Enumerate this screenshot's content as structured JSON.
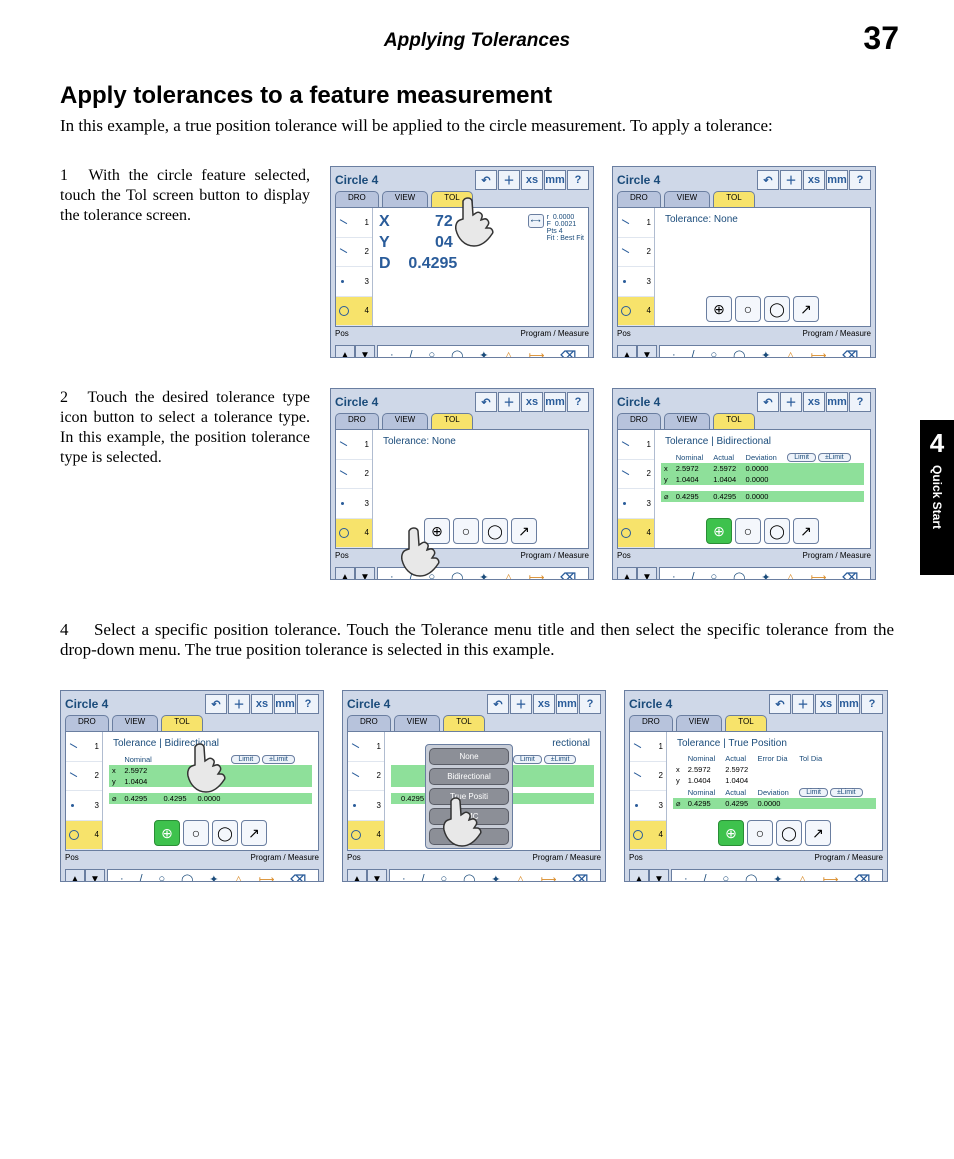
{
  "header": {
    "running_title": "Applying Tolerances",
    "page_number": "37"
  },
  "side_tab": {
    "chapter": "4",
    "label": "Quick Start"
  },
  "section_title": "Apply tolerances to a feature measurement",
  "intro": "In this example, a true position tolerance will be applied to the circle measurement. To apply a tolerance:",
  "steps": {
    "s1": "With the circle feature selected, touch the Tol screen button to display the tolerance screen.",
    "s2": "Touch the desired tolerance type icon button to select a tolerance type.  In this example, the position tolerance type is selected.",
    "s4": "Select a specific position tolerance.  Touch the Tolerance menu title and then select the specific tolerance from the drop-down menu.  The true position tolerance is selected in this example."
  },
  "step_num": {
    "s1": "1",
    "s2": "2",
    "s4": "4"
  },
  "panel": {
    "title": "Circle 4",
    "tabs": {
      "dro": "DRO",
      "view": "VIEW",
      "tol": "TOL"
    },
    "corner": {
      "undo": "↶",
      "plus": "＋",
      "xs": "xs",
      "mm": "mm",
      "help": "?"
    },
    "features": {
      "f1": "1",
      "f2": "2",
      "f3": "3",
      "f4": "4"
    },
    "status": {
      "pos": "Pos",
      "program": "Program",
      "measure": "Measure"
    },
    "arrows": {
      "up": "▲",
      "down": "▼"
    },
    "toolbar": {
      "dot": "·",
      "slash": "/",
      "circle": "○",
      "oval": "◯",
      "angle": "✦",
      "tri": "△",
      "dist": "⟼",
      "erase": "⌫"
    },
    "tol_btns": {
      "pos": "⊕",
      "conc": "○",
      "circ": "◯",
      "runout": "↗"
    }
  },
  "xyd": {
    "x_lbl": "X",
    "y_lbl": "Y",
    "d_lbl": "D",
    "x_val": "72",
    "y_val": "04",
    "d_val": "0.4295"
  },
  "meta": {
    "r2": "0.0000",
    "F": "F",
    "r3": "0.0021",
    "pts": "Pts 4",
    "fit": "Fit : Best Fit"
  },
  "tolerance": {
    "none": "Tolerance:  None",
    "bidir": "Tolerance | Bidirectional",
    "bidir_short": "rectional",
    "truepos": "Tolerance | True Position"
  },
  "table": {
    "hdr": {
      "nominal": "Nominal",
      "actual": "Actual",
      "dev": "Deviation",
      "limit": "Limit",
      "pLimit": "±Limit",
      "errdia": "Error Dia",
      "toldia": "Tol Dia"
    },
    "x": "x",
    "y": "y",
    "d": "⌀",
    "r1c1": "2.5972",
    "r1c2": "2.5972",
    "r1c3": "0.0000",
    "r2c1": "1.0404",
    "r2c2": "1.0404",
    "r2c3": "0.0000",
    "r3c1": "0.4295",
    "r3c2": "0.4295",
    "r3c3": "0.0000"
  },
  "dropdown": {
    "none": "None",
    "bidir": "Bidirectional",
    "tp": "True Positi",
    "mmc": "MMC",
    "lmc": "LMC"
  }
}
